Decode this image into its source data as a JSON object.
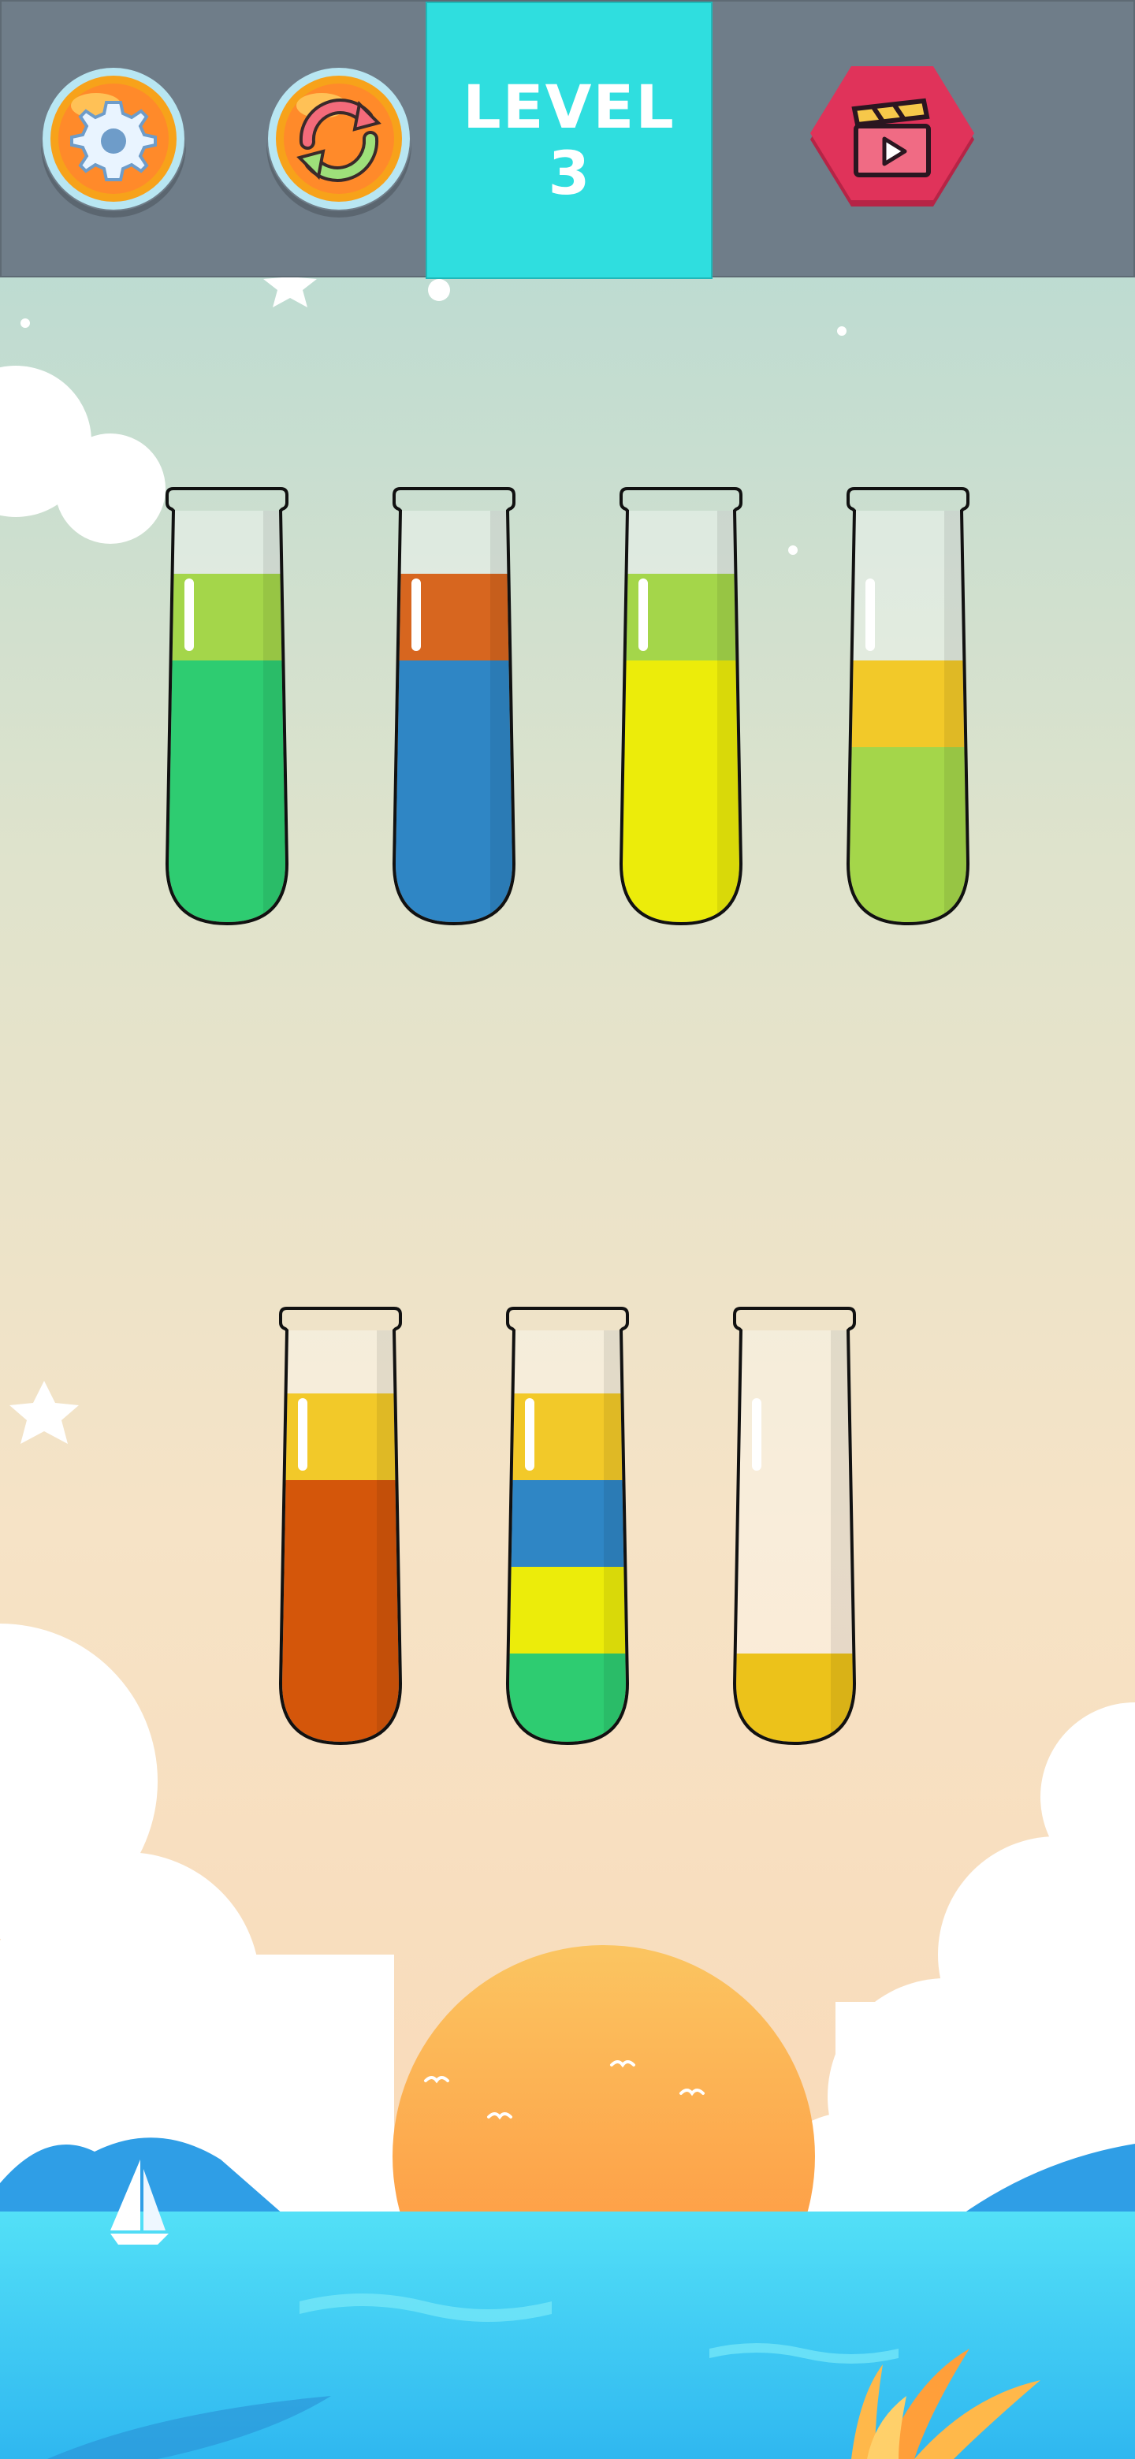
{
  "header": {
    "level_label": "LEVEL",
    "level_number": "3",
    "icons": {
      "settings": "gear-icon",
      "restart": "restart-arrows-icon",
      "video": "video-clapperboard-icon"
    }
  },
  "colors": {
    "header_bg": "#6f7d89",
    "level_panel": "#2fdedf",
    "video_hexagon": "#e0335a",
    "green": "#2ecc71",
    "lime": "#a4d64a",
    "orange": "#d7661f",
    "blue": "#2f86c5",
    "yellow": "#ecec0a",
    "gold": "#f2c929",
    "burnt_orange": "#d4560a",
    "dark_gold": "#ecc21a"
  },
  "board": {
    "tube_capacity": 4,
    "tubes": [
      {
        "layers_top_to_bottom": [
          "lime",
          "green",
          "green",
          "green"
        ]
      },
      {
        "layers_top_to_bottom": [
          "orange",
          "blue",
          "blue",
          "blue"
        ]
      },
      {
        "layers_top_to_bottom": [
          "lime",
          "yellow",
          "yellow",
          "yellow"
        ]
      },
      {
        "layers_top_to_bottom": [
          "gold",
          "lime",
          "lime"
        ]
      },
      {
        "layers_top_to_bottom": [
          "gold",
          "burnt_orange",
          "burnt_orange",
          "burnt_orange"
        ]
      },
      {
        "layers_top_to_bottom": [
          "gold",
          "blue",
          "yellow",
          "green"
        ]
      },
      {
        "layers_top_to_bottom": [
          "dark_gold"
        ]
      }
    ]
  }
}
